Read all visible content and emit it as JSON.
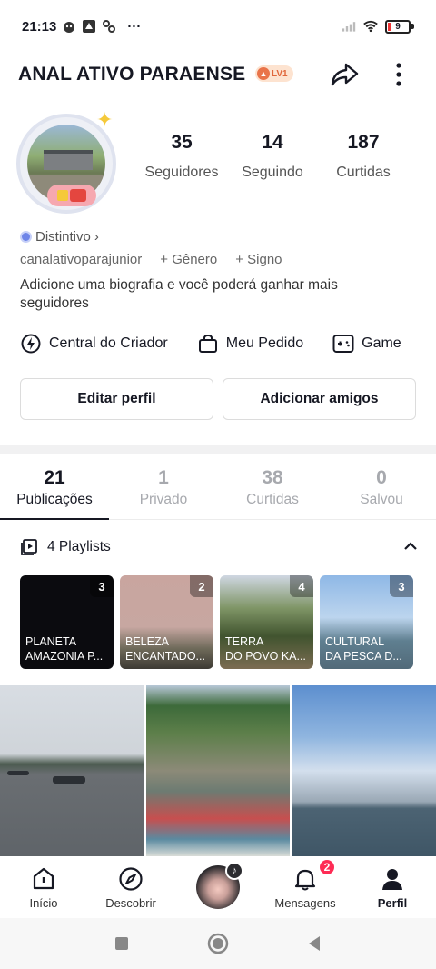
{
  "status_bar": {
    "time": "21:13",
    "more": "···",
    "battery_level": "9"
  },
  "header": {
    "profile_name": "ANAL ATIVO PARAENSE",
    "level_badge": "LV1"
  },
  "stats": [
    {
      "value": "35",
      "label": "Seguidores"
    },
    {
      "value": "14",
      "label": "Seguindo"
    },
    {
      "value": "187",
      "label": "Curtidas"
    }
  ],
  "profile": {
    "distintivo": "Distintivo",
    "username": "canalativoparajunior",
    "gender": "+ Gênero",
    "sign": "+ Signo",
    "bio": "Adicione uma biografia e você poderá ganhar mais seguidores"
  },
  "shortcuts": [
    {
      "label": "Central do Criador",
      "icon": "lightning-icon"
    },
    {
      "label": "Meu Pedido",
      "icon": "bag-icon"
    },
    {
      "label": "Game",
      "icon": "gamepad-icon"
    }
  ],
  "actions": {
    "edit": "Editar perfil",
    "add_friends": "Adicionar amigos"
  },
  "tabs": [
    {
      "num": "21",
      "label": "Publicações",
      "active": true
    },
    {
      "num": "1",
      "label": "Privado",
      "active": false
    },
    {
      "num": "38",
      "label": "Curtidas",
      "active": false
    },
    {
      "num": "0",
      "label": "Salvou",
      "active": false
    }
  ],
  "playlists": {
    "header": "4 Playlists",
    "items": [
      {
        "count": "3",
        "title": "PLANETA\nAMAZONIA P..."
      },
      {
        "count": "2",
        "title": "BELEZA\nENCANTADO..."
      },
      {
        "count": "4",
        "title": "TERRA\nDO POVO KA..."
      },
      {
        "count": "3",
        "title": "CULTURAL\nDA PESCA D..."
      }
    ]
  },
  "bottom_nav": {
    "home": "Início",
    "discover": "Descobrir",
    "messages": "Mensagens",
    "messages_badge": "2",
    "profile": "Perfil"
  },
  "colors": {
    "accent_red": "#fe2c55",
    "text_primary": "#161823",
    "text_muted": "#a7a9ae"
  }
}
